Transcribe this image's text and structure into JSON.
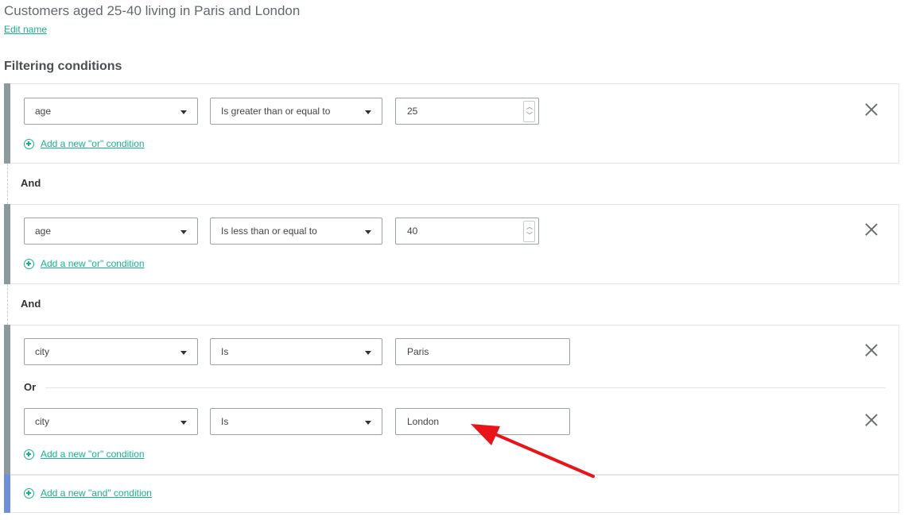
{
  "segment": {
    "name": "Customers aged 25-40 living in Paris and London",
    "edit_link": "Edit name"
  },
  "filters": {
    "section_title": "Filtering conditions",
    "and_label": "And",
    "or_label": "Or",
    "add_or_label": "Add a new \"or\" condition",
    "add_and_label": "Add a new \"and\" condition",
    "groups": [
      {
        "conditions": [
          {
            "field": "age",
            "operator": "Is greater than or equal to",
            "value": "25"
          }
        ]
      },
      {
        "conditions": [
          {
            "field": "age",
            "operator": "Is less than or equal to",
            "value": "40"
          }
        ]
      },
      {
        "conditions": [
          {
            "field": "city",
            "operator": "Is",
            "value": "Paris"
          },
          {
            "field": "city",
            "operator": "Is",
            "value": "London"
          }
        ]
      }
    ]
  },
  "icons": {
    "remove": "close-icon",
    "add": "plus-circle-icon",
    "dropdown": "caret-down-icon",
    "annotation": "red-arrow"
  },
  "colors": {
    "accent": "#19b08f",
    "group_bar": "#8c9a9b",
    "add_and_bar": "#6f8fd8",
    "annotation_arrow": "#e8141a"
  }
}
